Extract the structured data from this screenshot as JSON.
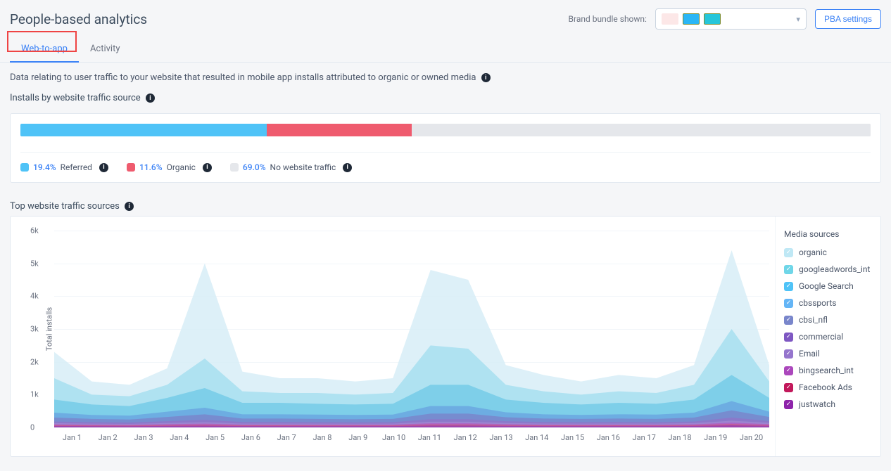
{
  "header": {
    "title": "People-based analytics",
    "bundle_label": "Brand bundle shown:",
    "pba_settings": "PBA settings"
  },
  "tabs": [
    {
      "label": "Web-to-app",
      "active": true
    },
    {
      "label": "Activity",
      "active": false
    }
  ],
  "description": "Data relating to user traffic to your website that resulted in mobile app installs attributed to organic or owned media",
  "installs_section": {
    "title": "Installs by website traffic source",
    "segments": [
      {
        "pct": "19.4%",
        "name": "Referred",
        "color": "#4fc3f7",
        "width": 29.0
      },
      {
        "pct": "11.6%",
        "name": "Organic",
        "color": "#ef5b6e",
        "width": 17.0
      },
      {
        "pct": "69.0%",
        "name": "No website traffic",
        "color": "#e5e7eb",
        "width": 54.0
      }
    ]
  },
  "sources_section": {
    "title": "Top website traffic sources",
    "legend_title": "Media sources",
    "ylabel": "Total installs",
    "sources": [
      {
        "name": "organic",
        "color": "#bfe8f5"
      },
      {
        "name": "googleadwords_int",
        "color": "#6fd6e8"
      },
      {
        "name": "Google Search",
        "color": "#4fc3f7"
      },
      {
        "name": "cbssports",
        "color": "#64b5f6"
      },
      {
        "name": "cbsi_nfl",
        "color": "#7986cb"
      },
      {
        "name": "commercial",
        "color": "#7e57c2"
      },
      {
        "name": "Email",
        "color": "#9575cd"
      },
      {
        "name": "bingsearch_int",
        "color": "#ab47bc"
      },
      {
        "name": "Facebook Ads",
        "color": "#c2185b"
      },
      {
        "name": "justwatch",
        "color": "#8e24aa"
      }
    ]
  },
  "chart_data": {
    "type": "area",
    "title": "Top website traffic sources",
    "xlabel": "",
    "ylabel": "Total installs",
    "ylim": [
      0,
      6000
    ],
    "yticks": [
      "0",
      "1k",
      "2k",
      "3k",
      "4k",
      "5k",
      "6k"
    ],
    "categories": [
      "Jan 1",
      "Jan 2",
      "Jan 3",
      "Jan 4",
      "Jan 5",
      "Jan 6",
      "Jan 7",
      "Jan 8",
      "Jan 9",
      "Jan 10",
      "Jan 11",
      "Jan 12",
      "Jan 13",
      "Jan 14",
      "Jan 15",
      "Jan 16",
      "Jan 17",
      "Jan 18",
      "Jan 19",
      "Jan 20"
    ],
    "series": [
      {
        "name": "organic",
        "color": "#d7edf7",
        "values": [
          2300,
          1400,
          1300,
          1800,
          5000,
          1700,
          1500,
          1500,
          1400,
          1500,
          4800,
          4500,
          1900,
          1600,
          1400,
          1600,
          1500,
          1900,
          5400,
          1900
        ]
      },
      {
        "name": "googleadwords_int",
        "color": "#a7dff0",
        "values": [
          1500,
          1000,
          950,
          1300,
          2100,
          1100,
          1050,
          1050,
          1000,
          1050,
          2500,
          2400,
          1300,
          1100,
          1000,
          1100,
          1050,
          1300,
          3000,
          1400
        ]
      },
      {
        "name": "Google Search",
        "color": "#76cbe8",
        "values": [
          850,
          700,
          650,
          900,
          1200,
          750,
          750,
          720,
          700,
          720,
          1300,
          1300,
          850,
          750,
          700,
          750,
          720,
          850,
          1600,
          900
        ]
      },
      {
        "name": "cbssports",
        "color": "#6aa7e0",
        "values": [
          450,
          380,
          360,
          480,
          600,
          400,
          400,
          390,
          380,
          390,
          650,
          650,
          460,
          400,
          380,
          400,
          390,
          450,
          800,
          480
        ]
      },
      {
        "name": "cbsi_nfl",
        "color": "#7986cb",
        "values": [
          300,
          260,
          240,
          320,
          400,
          270,
          270,
          260,
          250,
          260,
          420,
          420,
          310,
          270,
          260,
          270,
          260,
          300,
          520,
          320
        ]
      },
      {
        "name": "commercial",
        "color": "#8d76c9",
        "values": [
          180,
          160,
          150,
          190,
          230,
          165,
          165,
          160,
          155,
          160,
          250,
          250,
          190,
          165,
          160,
          165,
          160,
          180,
          300,
          195
        ]
      },
      {
        "name": "Email",
        "color": "#9f86d1",
        "values": [
          130,
          115,
          108,
          135,
          160,
          118,
          118,
          115,
          112,
          115,
          175,
          175,
          135,
          118,
          115,
          118,
          115,
          130,
          205,
          138
        ]
      },
      {
        "name": "bingsearch_int",
        "color": "#b15fc2",
        "values": [
          95,
          85,
          80,
          98,
          115,
          87,
          87,
          85,
          83,
          85,
          125,
          125,
          98,
          87,
          85,
          87,
          85,
          95,
          145,
          100
        ]
      },
      {
        "name": "Facebook Ads",
        "color": "#c85b8a",
        "values": [
          70,
          62,
          58,
          72,
          83,
          64,
          64,
          62,
          61,
          62,
          90,
          90,
          72,
          64,
          62,
          64,
          62,
          70,
          103,
          73
        ]
      },
      {
        "name": "justwatch",
        "color": "#9a3fb0",
        "values": [
          45,
          40,
          38,
          46,
          53,
          41,
          41,
          40,
          39,
          40,
          57,
          57,
          46,
          41,
          40,
          41,
          40,
          45,
          65,
          47
        ]
      }
    ]
  }
}
